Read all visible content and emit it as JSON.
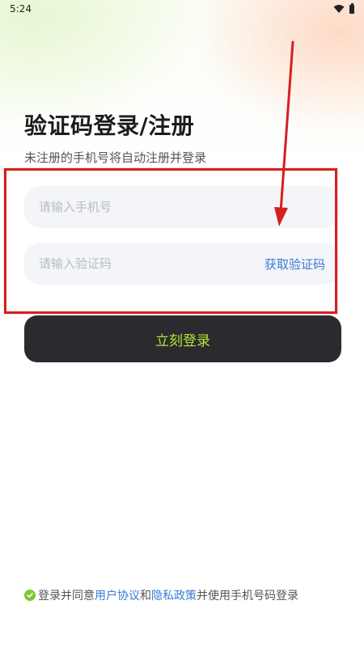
{
  "status_bar": {
    "time": "5:24",
    "wifi_icon": "wifi-icon",
    "battery_icon": "battery-icon"
  },
  "header": {
    "title": "验证码登录/注册",
    "subtitle": "未注册的手机号将自动注册并登录"
  },
  "form": {
    "phone_placeholder": "请输入手机号",
    "phone_value": "",
    "code_placeholder": "请输入验证码",
    "code_value": "",
    "get_code_label": "获取验证码"
  },
  "login_button": {
    "label": "立刻登录"
  },
  "agreement": {
    "prefix": "登录并同意",
    "user_agreement": "用户协议",
    "conj": "和",
    "privacy_policy": "隐私政策",
    "suffix": "并使用手机号码登录",
    "check_icon": "check-circle-icon"
  },
  "colors": {
    "accent_blue": "#3a7bd5",
    "button_bg": "#2b2b2f",
    "button_text": "#b4e634",
    "annotation_red": "#d42020",
    "check_green": "#7ec832"
  }
}
